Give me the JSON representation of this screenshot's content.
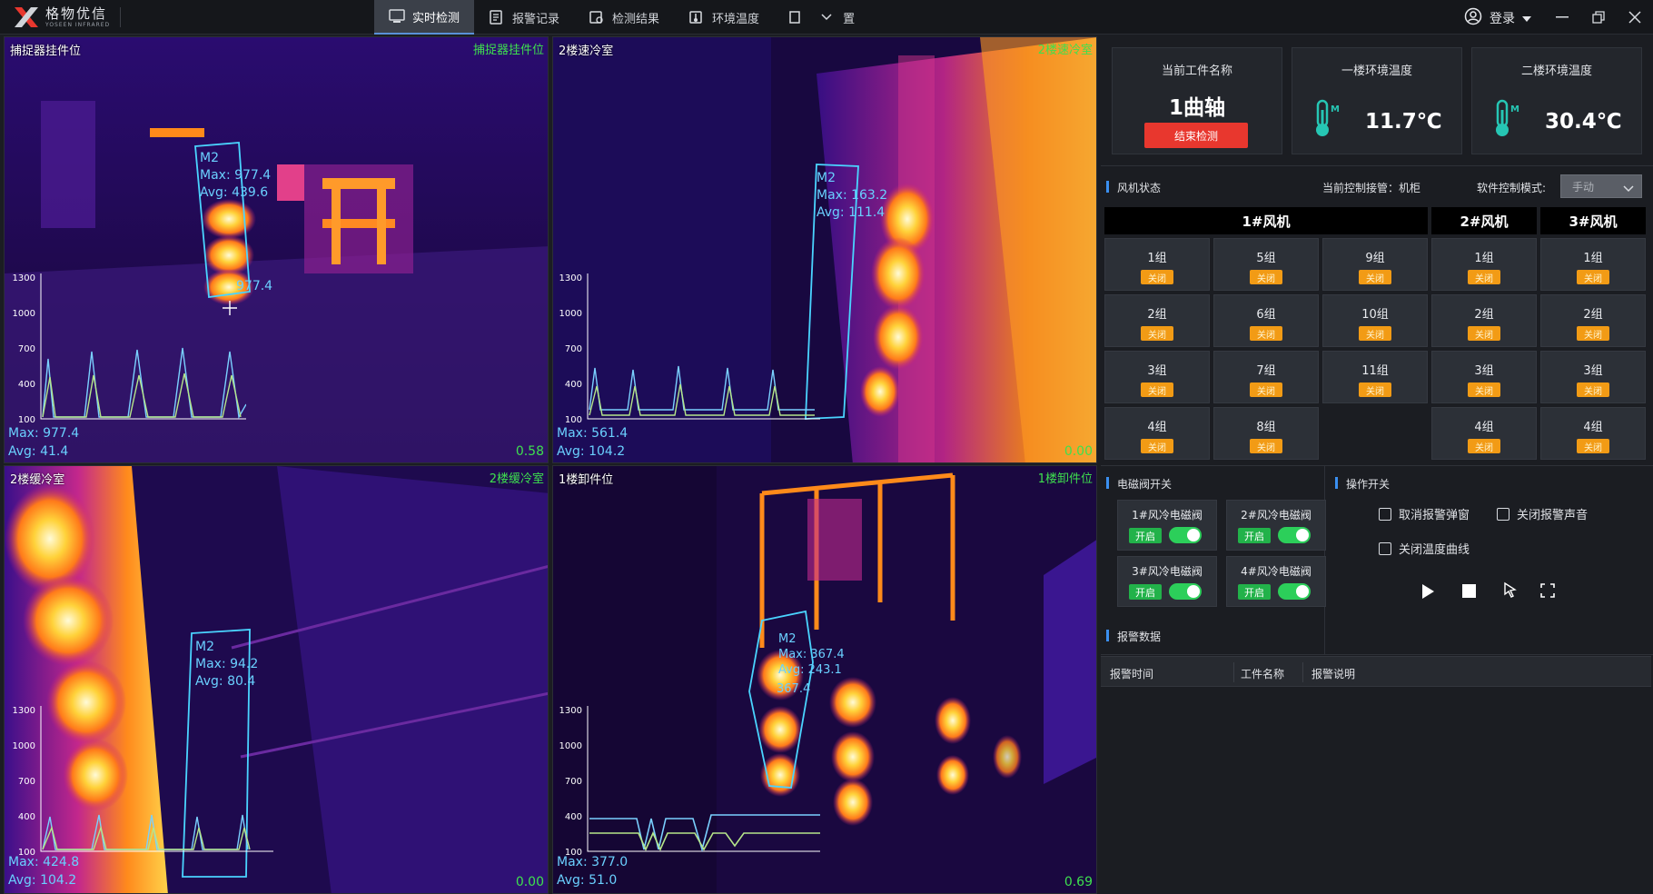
{
  "app": {
    "logo_cn": "格物优信",
    "logo_en": "YOSEEN INFRARED",
    "brand_color": "#e8372e",
    "login_label": "登录"
  },
  "tabs": [
    {
      "label": "实时检测",
      "icon": "monitor-icon",
      "active": true
    },
    {
      "label": "报警记录",
      "icon": "alarm-record-icon",
      "active": false
    },
    {
      "label": "检测结果",
      "icon": "result-icon",
      "active": false
    },
    {
      "label": "环境温度",
      "icon": "thermometer-icon",
      "active": false
    },
    {
      "label": "置",
      "icon": "settings-icon",
      "active": false
    }
  ],
  "cameras": [
    {
      "title": "捕捉器挂件位",
      "tag": "捕捉器挂件位",
      "roi_name": "M2",
      "roi_max": "Max: 977.4",
      "roi_avg": "Avg: 439.6",
      "roi_point": "977.4",
      "max": "Max: 977.4",
      "avg": "Avg: 41.4",
      "ratio": "0.58"
    },
    {
      "title": "2楼速冷室",
      "tag": "2楼速冷室",
      "roi_name": "M2",
      "roi_max": "Max: 163.2",
      "roi_avg": "Avg: 111.4",
      "max": "Max: 561.4",
      "avg": "Avg: 104.2",
      "ratio": "0.00"
    },
    {
      "title": "2楼缓冷室",
      "tag": "2楼缓冷室",
      "roi_name": "M2",
      "roi_max": "Max: 94.2",
      "roi_avg": "Avg: 80.4",
      "max": "Max: 424.8",
      "avg": "Avg: 104.2",
      "ratio": "0.00"
    },
    {
      "title": "1楼卸件位",
      "tag": "1楼卸件位",
      "roi_name": "M2",
      "roi_max": "Max: 367.4",
      "roi_avg": "Avg: 243.1",
      "roi_point": "367.4",
      "max": "Max: 377.0",
      "avg": "Avg: 51.0",
      "ratio": "0.69"
    }
  ],
  "curve_axis": [
    "1300",
    "1000",
    "700",
    "400",
    "100"
  ],
  "cards": {
    "workpiece_title": "当前工件名称",
    "workpiece_value": "1曲轴",
    "end_button": "结束检测",
    "floor1_title": "一楼环境温度",
    "floor1_value": "11.7℃",
    "floor2_title": "二楼环境温度",
    "floor2_value": "30.4℃"
  },
  "fan": {
    "section_title": "风机状态",
    "control_owner": "当前控制接管：机柜",
    "mode_label": "软件控制模式:",
    "mode_value": "手动",
    "headers": [
      "1#风机",
      "2#风机",
      "3#风机"
    ],
    "off_label": "关闭",
    "off_color": "#f29b15",
    "groups": {
      "fan1_col1": [
        "1组",
        "2组",
        "3组",
        "4组"
      ],
      "fan1_col2": [
        "5组",
        "6组",
        "7组",
        "8组"
      ],
      "fan1_col3": [
        "9组",
        "10组",
        "11组"
      ],
      "fan2": [
        "1组",
        "2组",
        "3组",
        "4组"
      ],
      "fan3": [
        "1组",
        "2组",
        "3组",
        "4组"
      ]
    }
  },
  "valves": {
    "section_title": "电磁阀开关",
    "on_label": "开启",
    "on_color": "#22b24a",
    "items": [
      "1#风冷电磁阀",
      "2#风冷电磁阀",
      "3#风冷电磁阀",
      "4#风冷电磁阀"
    ]
  },
  "ops": {
    "section_title": "操作开关",
    "cancel_popup": "取消报警弹窗",
    "mute_alarm": "关闭报警声音",
    "hide_curve": "关闭温度曲线"
  },
  "alarms": {
    "section_title": "报警数据",
    "columns": [
      "报警时间",
      "工件名称",
      "报警说明"
    ]
  }
}
